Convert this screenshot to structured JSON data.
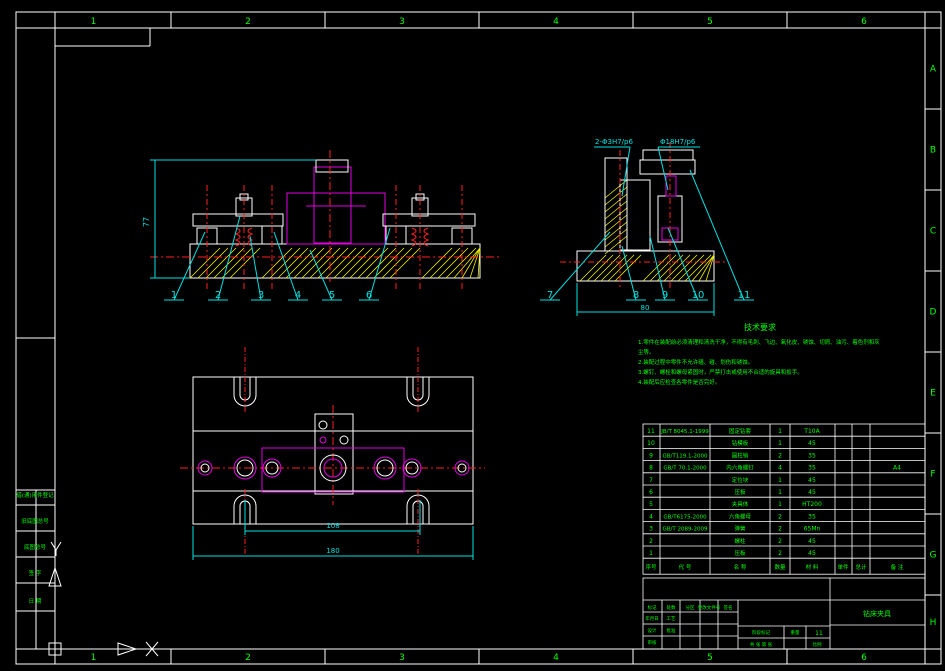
{
  "colors": {
    "frame": "#ffffff",
    "part": "#ffffff",
    "hatch": "#f0f000",
    "dimension": "#00e0e0",
    "center": "#ff2020",
    "spring": "#ff2020",
    "magenta": "#e000e0",
    "text_green": "#00ff00",
    "table_line": "#ffffff"
  },
  "sheet": {
    "zone_columns": [
      "1",
      "2",
      "3",
      "4",
      "5",
      "6"
    ],
    "zone_rows": [
      "A",
      "B",
      "C",
      "D",
      "E",
      "F",
      "G",
      "H"
    ]
  },
  "front_view": {
    "height_dim": "77",
    "balloons": [
      "1",
      "2",
      "3",
      "4",
      "5",
      "6"
    ]
  },
  "side_view": {
    "fit_left": "2-Φ3H7/p6",
    "fit_right": "Φ18H7/p6",
    "width_dim": "80",
    "balloons": [
      "7",
      "8",
      "9",
      "10",
      "11"
    ]
  },
  "top_view": {
    "inner_dim": "108",
    "outer_dim": "180"
  },
  "notes": {
    "title": "技术要求",
    "lines": [
      "1.零件在装配前必须清理和清洗干净，不得有毛刺、飞边、氧化皮、锈蚀、切屑、油污、着色剂和灰",
      "尘等。",
      "2.装配过程中零件不允许磕、碰、划伤和锈蚀。",
      "3.螺钉、螺栓和螺母紧固时，严禁打击或使用不合适的旋具和扳手。",
      "4.装配后应检查各零件是否完好。"
    ]
  },
  "bom": {
    "rows": [
      {
        "no": "11",
        "std": "JB/T 8045.1-1999",
        "name": "固定钻套",
        "qty": "1",
        "mat": "T10A",
        "note": ""
      },
      {
        "no": "10",
        "std": "",
        "name": "钻模板",
        "qty": "1",
        "mat": "45",
        "note": ""
      },
      {
        "no": "9",
        "std": "GB/T119.1-2000",
        "name": "圆柱销",
        "qty": "2",
        "mat": "35",
        "note": ""
      },
      {
        "no": "8",
        "std": "GB/T 70.1-2000",
        "name": "内六角螺钉",
        "qty": "4",
        "mat": "35",
        "note": "A4"
      },
      {
        "no": "7",
        "std": "",
        "name": "定位块",
        "qty": "1",
        "mat": "45",
        "note": ""
      },
      {
        "no": "6",
        "std": "",
        "name": "压板",
        "qty": "1",
        "mat": "45",
        "note": ""
      },
      {
        "no": "5",
        "std": "",
        "name": "夹具体",
        "qty": "1",
        "mat": "HT200",
        "note": ""
      },
      {
        "no": "4",
        "std": "GB/T6175-2000",
        "name": "六角螺母",
        "qty": "2",
        "mat": "35",
        "note": ""
      },
      {
        "no": "3",
        "std": "GB/T 2089-2009",
        "name": "弹簧",
        "qty": "2",
        "mat": "65Mn",
        "note": ""
      },
      {
        "no": "2",
        "std": "",
        "name": "螺柱",
        "qty": "2",
        "mat": "45",
        "note": ""
      },
      {
        "no": "1",
        "std": "",
        "name": "压板",
        "qty": "2",
        "mat": "45",
        "note": ""
      }
    ],
    "header": [
      "序号",
      "代 号",
      "名 称",
      "数量",
      "材 料",
      "单件",
      "总计",
      "备 注"
    ]
  },
  "title_block": {
    "drawing_name": "钻床夹具",
    "sheet_count": "11",
    "labels": [
      "标记",
      "处数",
      "分区",
      "更改文件号",
      "签名",
      "年月日",
      "设计",
      "审核",
      "工艺",
      "批准",
      "阶段标记",
      "重量",
      "比例",
      "共 张 第 张"
    ]
  },
  "sidebar": [
    "借(通)用件登记",
    "旧底图总号",
    "底图总号",
    "签 字",
    "日 期"
  ]
}
